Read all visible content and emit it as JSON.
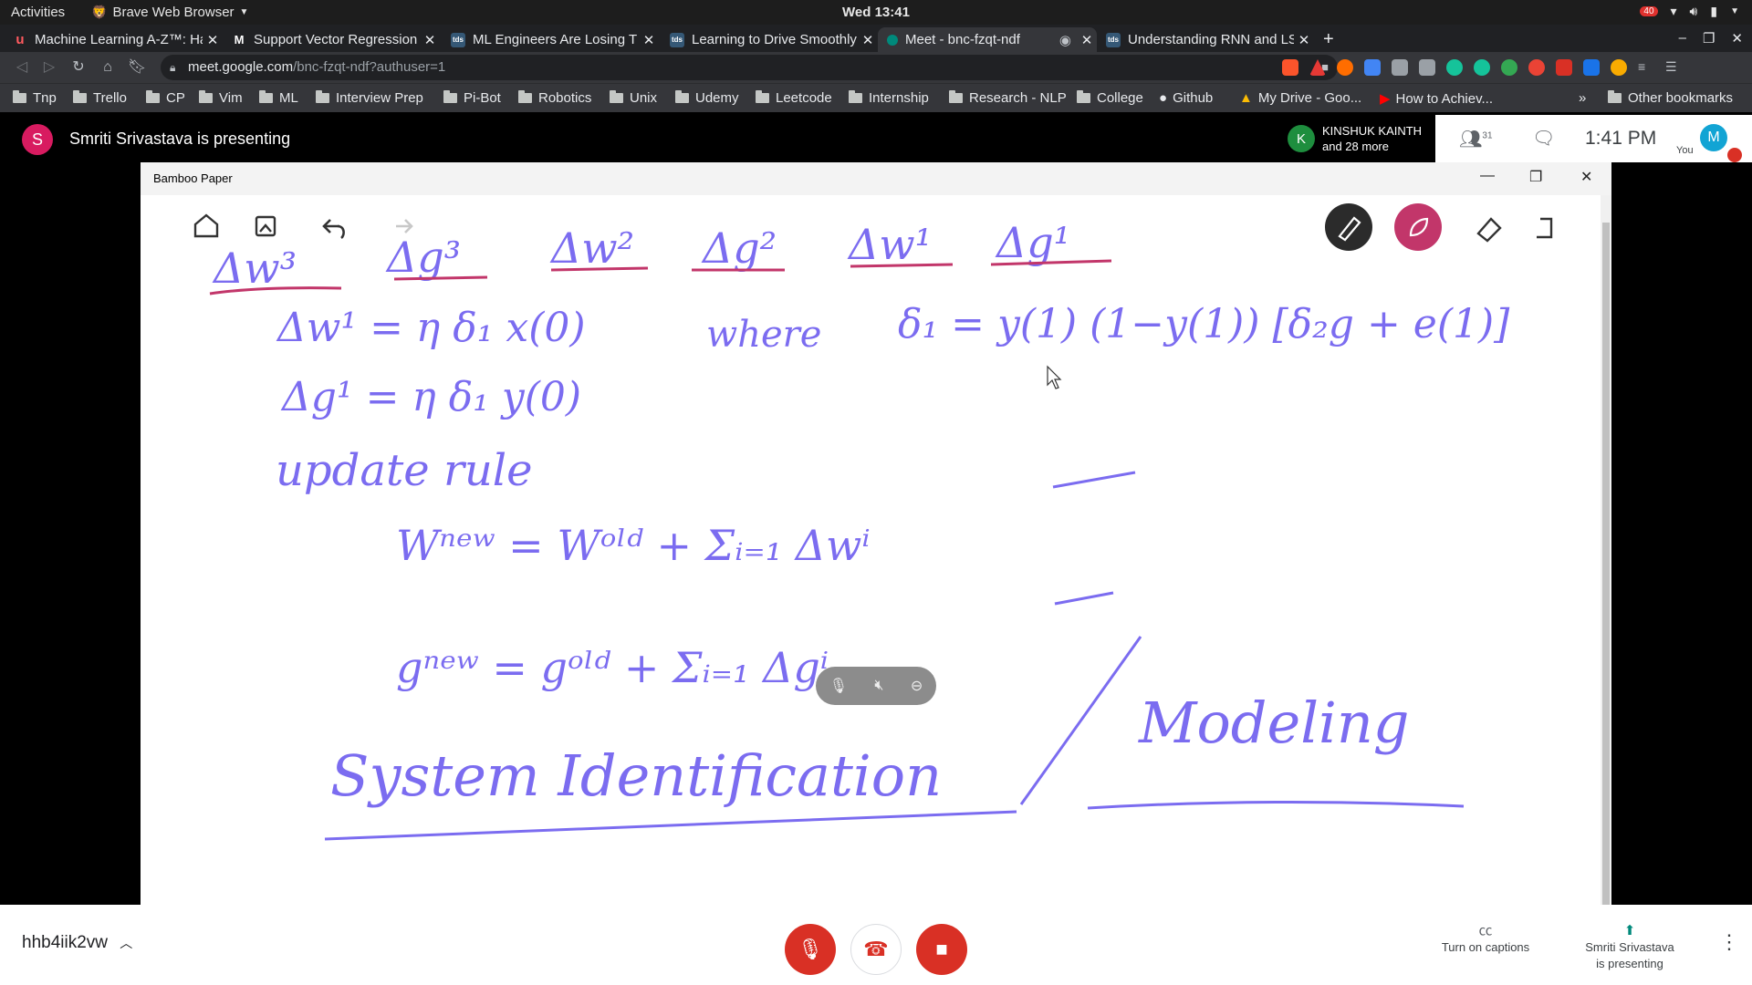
{
  "topbar": {
    "activities": "Activities",
    "app_name": "Brave Web Browser",
    "clock": "Wed 13:41",
    "notification_count": "40"
  },
  "tabs": [
    {
      "title": "Machine Learning A-Z™: Ha",
      "favicon": "udemy-icon",
      "color": "#a435f0"
    },
    {
      "title": "Support Vector Regression",
      "favicon": "medium-icon",
      "color": "#000000"
    },
    {
      "title": "ML Engineers Are Losing T",
      "favicon": "tds-icon",
      "color": "#355876"
    },
    {
      "title": "Learning to Drive Smoothly",
      "favicon": "tds-icon",
      "color": "#355876"
    },
    {
      "title": "Meet - bnc-fzqt-ndf",
      "favicon": "meet-icon",
      "color": "#00897b"
    },
    {
      "title": "Understanding RNN and LS",
      "favicon": "tds-icon",
      "color": "#355876"
    }
  ],
  "address": {
    "host": "meet.google.com",
    "path": "/bnc-fzqt-ndf?authuser=1"
  },
  "bookmarks": [
    {
      "label": "Tnp"
    },
    {
      "label": "Trello"
    },
    {
      "label": "CP"
    },
    {
      "label": "Vim"
    },
    {
      "label": "ML"
    },
    {
      "label": "Interview Prep"
    },
    {
      "label": "Pi-Bot"
    },
    {
      "label": "Robotics"
    },
    {
      "label": "Unix"
    },
    {
      "label": "Udemy"
    },
    {
      "label": "Leetcode"
    },
    {
      "label": "Internship"
    },
    {
      "label": "Research - NLP"
    },
    {
      "label": "College"
    },
    {
      "label": "Github"
    },
    {
      "label": "My Drive - Goo..."
    },
    {
      "label": "How to Achiev..."
    }
  ],
  "other_bookmarks": "Other bookmarks",
  "meet": {
    "presenter_initial": "S",
    "presenter_banner": "Smriti Srivastava is presenting",
    "participant_name": "KINSHUK KAINTH",
    "participant_more": "and 28 more",
    "participant_initial": "K",
    "people_count": "31",
    "time": "1:41 PM",
    "you_initial": "M",
    "you_label": "You",
    "meeting_code": "hhb4iik2vw",
    "captions_label": "Turn on captions",
    "presenting_label_1": "Smriti Srivastava",
    "presenting_label_2": "is presenting"
  },
  "bamboo": {
    "title": "Bamboo Paper",
    "lines": {
      "deltas": [
        "Δw³",
        "Δg³",
        "Δw²",
        "Δg²",
        "Δw¹",
        "Δg¹"
      ],
      "eq1": "Δw¹ = η δ₁ x(0)",
      "where": "where",
      "delta_def": "δ₁ = y(1) (1−y(1)) [δ₂g + e(1)]",
      "eq2": "Δg¹ = η δ₁ y(0)",
      "update": "update rule",
      "wnew": "Wⁿᵉʷ = Wᵒˡᵈ + Σᵢ₌₁ Δwⁱ",
      "gnew": "gⁿᵉʷ = gᵒˡᵈ + Σᵢ₌₁ Δgⁱ",
      "sysid": "System Identification",
      "modeling": "Modeling"
    }
  }
}
